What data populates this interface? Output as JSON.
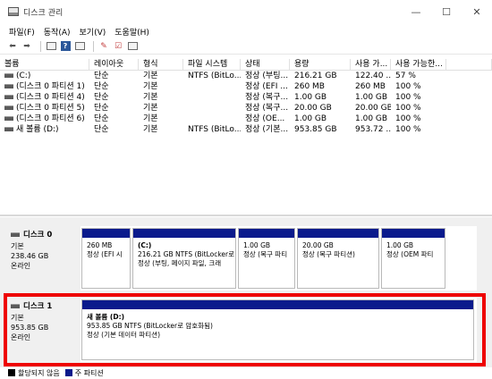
{
  "window": {
    "title": "디스크 관리",
    "controls": [
      "—",
      "☐",
      "✕"
    ]
  },
  "menu": [
    "파일(F)",
    "동작(A)",
    "보기(V)",
    "도움말(H)"
  ],
  "toolbar_icons": [
    "back-arrow-icon",
    "forward-arrow-icon",
    "disk-list-icon",
    "help-icon",
    "properties-icon",
    "refresh-icon",
    "settings-icon"
  ],
  "volumes": {
    "headers": [
      "볼륨",
      "레이아웃",
      "형식",
      "파일 시스템",
      "상태",
      "용량",
      "사용 가...",
      "사용 가능한..."
    ],
    "rows": [
      [
        "(C:)",
        "단순",
        "기본",
        "NTFS (BitLo...",
        "정상 (부팅...",
        "216.21 GB",
        "122.40 ...",
        "57 %"
      ],
      [
        "(디스크 0 파티션 1)",
        "단순",
        "기본",
        "",
        "정상 (EFI ...",
        "260 MB",
        "260 MB",
        "100 %"
      ],
      [
        "(디스크 0 파티션 4)",
        "단순",
        "기본",
        "",
        "정상 (복구...",
        "1.00 GB",
        "1.00 GB",
        "100 %"
      ],
      [
        "(디스크 0 파티션 5)",
        "단순",
        "기본",
        "",
        "정상 (복구...",
        "20.00 GB",
        "20.00 GB",
        "100 %"
      ],
      [
        "(디스크 0 파티션 6)",
        "단순",
        "기본",
        "",
        "정상 (OE...",
        "1.00 GB",
        "1.00 GB",
        "100 %"
      ],
      [
        "새 볼륨 (D:)",
        "단순",
        "기본",
        "NTFS (BitLo...",
        "정상 (기본...",
        "953.85 GB",
        "953.72 ...",
        "100 %"
      ]
    ]
  },
  "disks": [
    {
      "name": "디스크 0",
      "type": "기본",
      "size": "238.46 GB",
      "status": "온라인",
      "partitions": [
        {
          "name": "",
          "line1": "260 MB",
          "line2": "정상 (EFI 시"
        },
        {
          "name": "(C:)",
          "line1": "216.21 GB NTFS (BitLocker로",
          "line2": "정상 (부팅, 페이지 파일, 크래"
        },
        {
          "name": "",
          "line1": "1.00 GB",
          "line2": "정상 (복구 파티"
        },
        {
          "name": "",
          "line1": "20.00 GB",
          "line2": "정상 (복구 파티션)"
        },
        {
          "name": "",
          "line1": "1.00 GB",
          "line2": "정상 (OEM 파티"
        }
      ]
    },
    {
      "name": "디스크 1",
      "type": "기본",
      "size": "953.85 GB",
      "status": "온라인",
      "partitions": [
        {
          "name": "새 볼륨 (D:)",
          "line1": "953.85 GB NTFS (BitLocker로 암호화됨)",
          "line2": "정상 (기본 데이터 파티션)"
        }
      ]
    }
  ],
  "legend": [
    {
      "label": "할당되지 않음",
      "color": "#000000"
    },
    {
      "label": "주 파티션",
      "color": "#0a1a8c"
    }
  ],
  "highlight_color": "#ee0000"
}
